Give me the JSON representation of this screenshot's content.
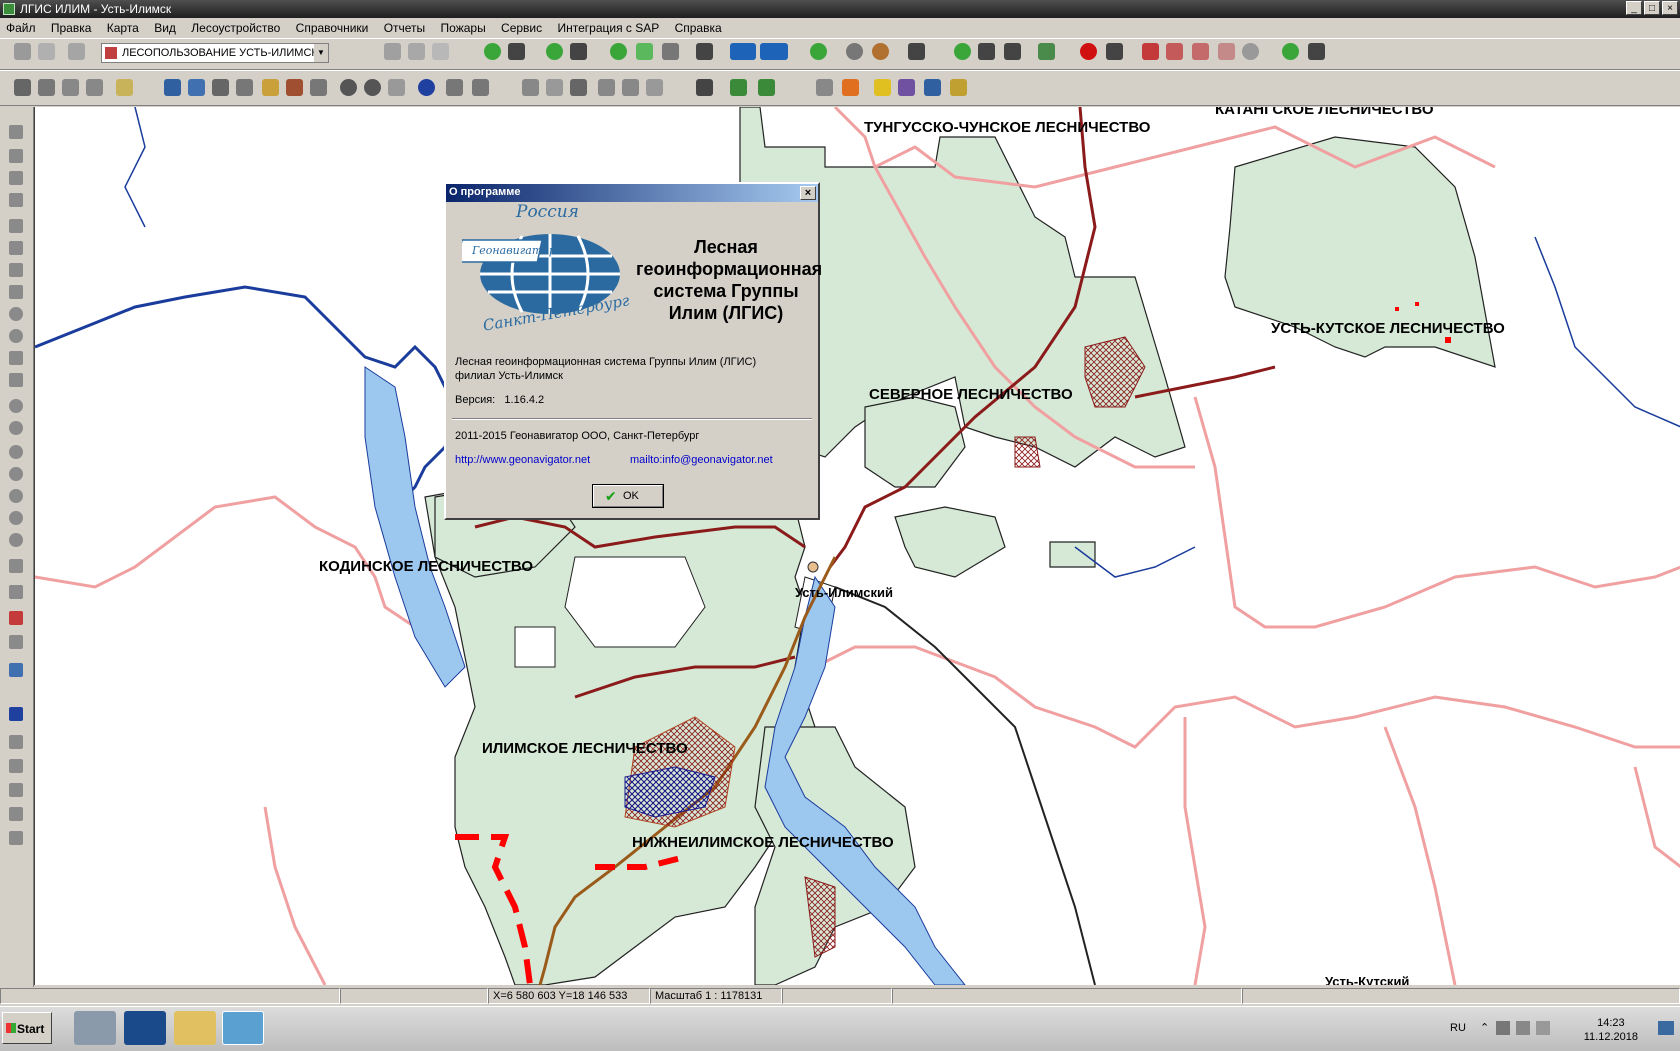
{
  "window": {
    "title": "ЛГИС ИЛИМ - Усть-Илимск",
    "buttons": [
      "_",
      "□",
      "×"
    ]
  },
  "menu": [
    "Файл",
    "Правка",
    "Карта",
    "Вид",
    "Лесоустройство",
    "Справочники",
    "Отчеты",
    "Пожары",
    "Сервис",
    "Интеграция с SAP",
    "Справка"
  ],
  "toolbar": {
    "layer_select_value": "ЛЕСОПОЛЬЗОВАНИЕ УСТЬ-ИЛИМСК"
  },
  "map": {
    "labels": {
      "tungussko": "ТУНГУССКО-ЧУНСКОЕ ЛЕСНИЧЕСТВО",
      "katangskoe": "КАТАНГСКОЕ ЛЕСНИЧЕСТВО",
      "ust_kutskoe": "УСТЬ-КУТСКОЕ ЛЕСНИЧЕСТВО",
      "severnoe": "СЕВЕРНОЕ ЛЕСНИЧЕСТВО",
      "kodinskoe": "КОДИНСКОЕ ЛЕСНИЧЕСТВО",
      "ilimskoe": "ИЛИМСКОЕ ЛЕСНИЧЕСТВО",
      "nizhneilimskoe": "НИЖНЕИЛИМСКОЕ ЛЕСНИЧЕСТВО",
      "ust_ilimsky": "Усть-Илимский",
      "ust_kutsky": "Усть-Кутский"
    }
  },
  "dialog": {
    "title": "О программе",
    "product_name_lines": [
      "Лесная",
      "геоинформационная",
      "система Группы",
      "Илим (ЛГИС)"
    ],
    "logo_top": "Россия",
    "logo_mid": "Геонавигатор",
    "logo_bottom": "Санкт-Петербург",
    "desc_line1": "Лесная геоинформационная система Группы Илим (ЛГИС)",
    "desc_line2": "филиал Усть-Илимск",
    "version_label": "Версия:",
    "version": "1.16.4.2",
    "copyright": "2011-2015 Геонавигатор ООО, Санкт-Петербург",
    "url": "http://www.geonavigator.net",
    "mail": "mailto:info@geonavigator.net",
    "ok_label": "OK"
  },
  "status": {
    "coords": "X=6 580 603 Y=18 146 533",
    "scale": "Масштаб 1 : 1178131"
  },
  "taskbar": {
    "start_label": "Start",
    "lang": "RU",
    "time": "14:23",
    "date": "11.12.2018"
  },
  "colors": {
    "forest_fill": "#d6e9d6",
    "border_pink": "#f0a0a0",
    "river": "#1a3c9c",
    "road_dark": "#8b1a1a",
    "dialog_title": "#0a246a"
  }
}
